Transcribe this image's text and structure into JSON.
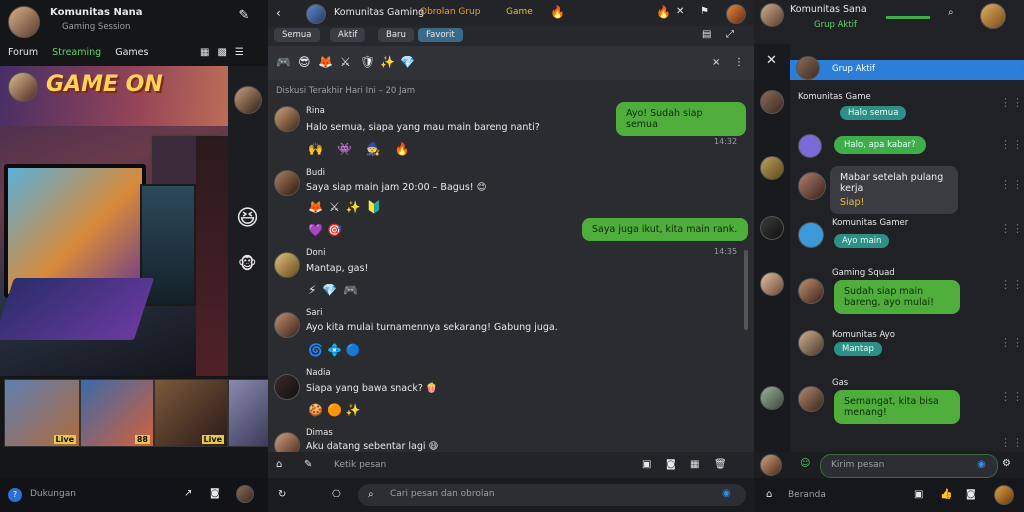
{
  "left": {
    "header": {
      "title": "Komunitas Nana",
      "subtitle": "Gaming Session"
    },
    "tabs": [
      "Forum",
      "Streaming",
      "Games"
    ],
    "stream_title": "GAME ON",
    "thumbnails": [
      "Live",
      "88",
      "Live"
    ],
    "bottom": {
      "status": "Dukungan"
    }
  },
  "mid": {
    "header": {
      "name": "Komunitas Gaming",
      "tag1": "Obrolan Grup",
      "tag2": "Game"
    },
    "tabs": [
      "Semua",
      "Aktif",
      "Baru",
      "Favorit"
    ],
    "date_line": "Diskusi Terakhir Hari Ini – 20 Jam",
    "messages": [
      {
        "name": "Rina",
        "text": "Halo semua, siapa yang mau main bareng nanti?"
      },
      {
        "name": "Budi",
        "text": "Saya siap main jam 20:00 – Bagus! 😊"
      },
      {
        "name": "Doni",
        "text": "Mantap, gas!"
      },
      {
        "name": "Sari",
        "text": "Ayo kita mulai turnamennya sekarang! Gabung juga."
      },
      {
        "name": "Nadia",
        "text": "Siapa yang bawa snack? 🍿"
      },
      {
        "name": "Dimas",
        "text": "Aku datang sebentar lagi 😄"
      }
    ],
    "outgoing": [
      {
        "text": "Ayo! Sudah siap semua",
        "time": "14:32"
      },
      {
        "text": "Saya juga ikut, kita main rank.",
        "time": "14:35"
      }
    ],
    "composer_placeholder": "Ketik pesan",
    "search_placeholder": "Cari pesan dan obrolan"
  },
  "right": {
    "header": {
      "name": "Komunitas Sana",
      "subtitle": "Grup Aktif"
    },
    "highlight": "Grup Aktif",
    "messages": [
      {
        "name": "Komunitas Game",
        "tag": "Halo semua"
      },
      {
        "name": "",
        "tag": "Halo, apa kabar?"
      },
      {
        "name": "",
        "dark": "Mabar setelah pulang kerja",
        "sub": "Siap!"
      },
      {
        "name": "Komunitas Gamer",
        "tag": "Ayo main"
      },
      {
        "name": "Gaming Squad",
        "green": "Sudah siap main bareng, ayo mulai!"
      },
      {
        "name": "Komunitas Ayo",
        "tag": "Mantap"
      },
      {
        "name": "Gas",
        "green": "Semangat, kita bisa menang!"
      }
    ],
    "composer_placeholder": "Kirim pesan",
    "bottom_label": "Beranda"
  }
}
